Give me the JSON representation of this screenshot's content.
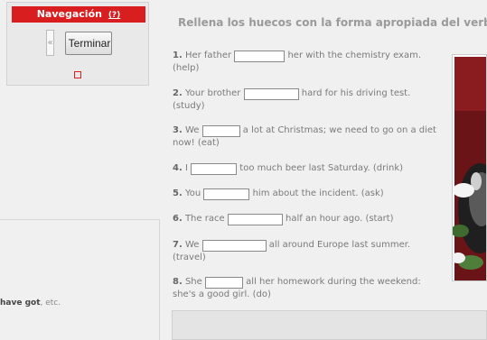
{
  "navigation": {
    "title": "Navegación",
    "help": "(?)",
    "prev": "«",
    "finish_label": "Terminar"
  },
  "heading": "Rellena los huecos con la forma apropiada del verbo e",
  "questions": [
    {
      "num": "1.",
      "before": "Her father",
      "after": "her with the chemistry exam. (help)"
    },
    {
      "num": "2.",
      "before": "Your brother",
      "after": "hard for his driving test. (study)"
    },
    {
      "num": "3.",
      "before": "We",
      "after": "a lot at Christmas; we need to go on a diet now! (eat)"
    },
    {
      "num": "4.",
      "before": "I",
      "after": "too much beer last Saturday. (drink)"
    },
    {
      "num": "5.",
      "before": "You",
      "after": "him about the incident. (ask)"
    },
    {
      "num": "6.",
      "before": "The race",
      "after": "half an hour ago. (start)"
    },
    {
      "num": "7.",
      "before": "We",
      "after": "all around Europe last summer. (travel)"
    },
    {
      "num": "8.",
      "before": "She",
      "after": "all her homework during the weekend: she's a good girl. (do)"
    }
  ],
  "left_note": {
    "bold": "have got",
    "rest": ", etc."
  },
  "colors": {
    "accent": "#d81e1e",
    "background": "#f0f0f0"
  }
}
